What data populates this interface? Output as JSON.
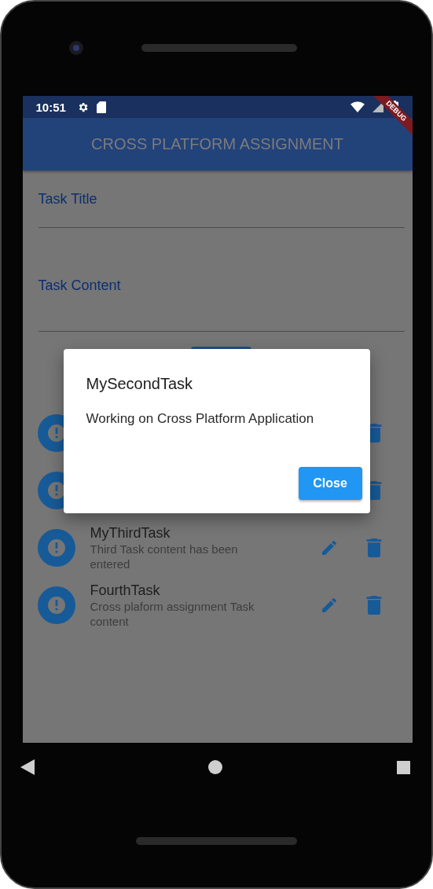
{
  "status_bar": {
    "time": "10:51"
  },
  "app_bar": {
    "title": "CROSS PLATFORM ASSIGNMENT"
  },
  "debug_banner": {
    "label": "DEBUG"
  },
  "form": {
    "fields": [
      {
        "label": "Task Title"
      },
      {
        "label": "Task Content"
      }
    ]
  },
  "tasks": [
    {
      "kind": "covered"
    },
    {
      "kind": "covered"
    },
    {
      "kind": "task",
      "title": "MyThirdTask",
      "content": "Third Task content has been entered"
    },
    {
      "kind": "task",
      "title": "FourthTask",
      "content": "Cross plaform assignment Task content"
    }
  ],
  "dialog": {
    "title": "MySecondTask",
    "message": "Working on Cross Platform Application",
    "buttons": [
      "Close"
    ]
  }
}
